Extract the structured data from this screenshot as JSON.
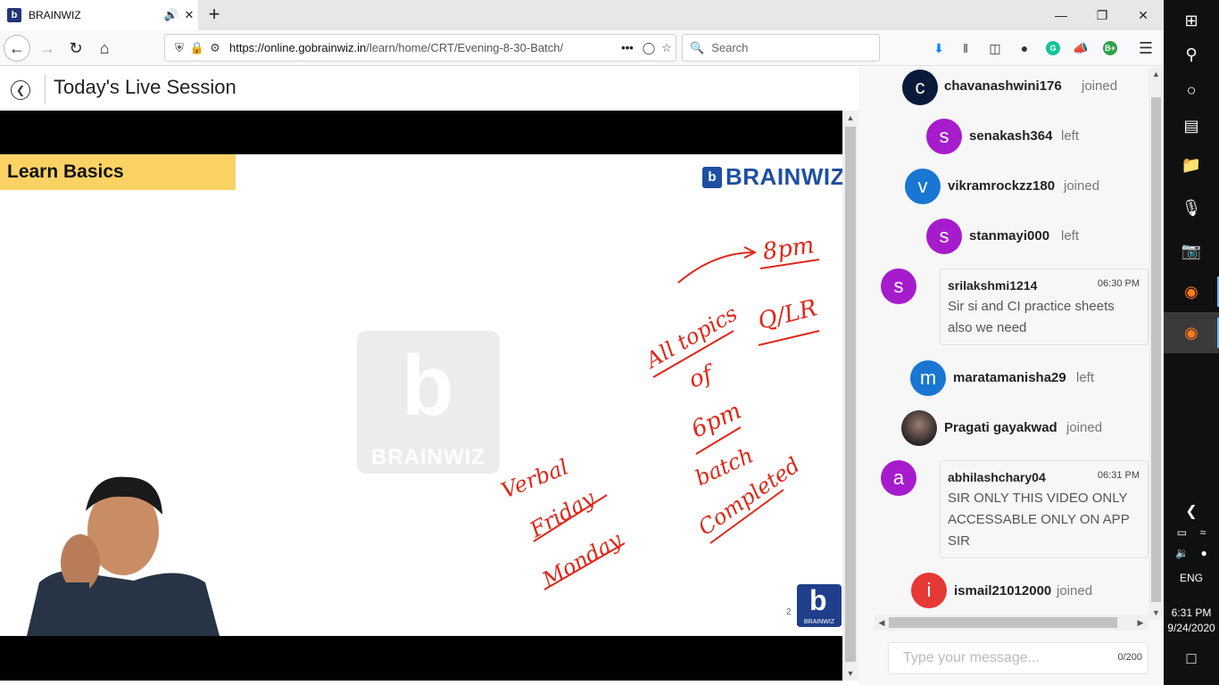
{
  "browser": {
    "tab_title": "BRAINWIZ",
    "favicon_letter": "b",
    "url_domain": "https://online.gobrainwiz.in",
    "url_path": "/learn/home/CRT/Evening-8-30-Batch/",
    "search_placeholder": "Search"
  },
  "page": {
    "title": "Today's Live Session"
  },
  "slide": {
    "banner": "Learn Basics",
    "logo_text": "BRAINWIZ",
    "logo_mark": "b",
    "watermark_text": "BRAINWIZ",
    "watermark_mark": "b",
    "page_number": "2",
    "corner_logo_text": "BRAINWIZ",
    "handwriting": {
      "8pm": "8pm",
      "qlr": "Q/LR",
      "all_topics": "All topics",
      "of": "of",
      "6pm": "6pm",
      "batch": "batch",
      "completed": "Completed",
      "verbal": "Verbal",
      "friday": "Friday",
      "monday": "Monday"
    }
  },
  "chat": {
    "events": [
      {
        "initial": "c",
        "name": "chavanashwini176",
        "action": "joined"
      },
      {
        "initial": "s",
        "name": "senakash364",
        "action": "left"
      },
      {
        "initial": "v",
        "name": "vikramrockzz180",
        "action": "joined"
      },
      {
        "initial": "s",
        "name": "stanmayi000",
        "action": "left"
      },
      {
        "initial": "m",
        "name": "maratamanisha29",
        "action": "left"
      },
      {
        "initial": "",
        "name": "Pragati gayakwad",
        "action": "joined"
      },
      {
        "initial": "i",
        "name": "ismail21012000",
        "action": "joined"
      }
    ],
    "messages": [
      {
        "initial": "s",
        "name": "srilakshmi1214",
        "time": "06:30 PM",
        "text": "Sir si and CI practice sheets also we need"
      },
      {
        "initial": "a",
        "name": "abhilashchary04",
        "time": "06:31 PM",
        "text": "SIR ONLY THIS VIDEO ONLY ACCESSABLE ONLY ON APP SIR"
      }
    ],
    "input_placeholder": "Type your message...",
    "counter": "0/200"
  },
  "taskbar": {
    "language": "ENG",
    "time": "6:31 PM",
    "date": "9/24/2020"
  },
  "colors": {
    "purple": "#a61ccc",
    "blue": "#1976d2",
    "navy": "#0b1a3a",
    "red": "#e53935",
    "ink": "#e0261a",
    "banner": "#fdd264"
  }
}
